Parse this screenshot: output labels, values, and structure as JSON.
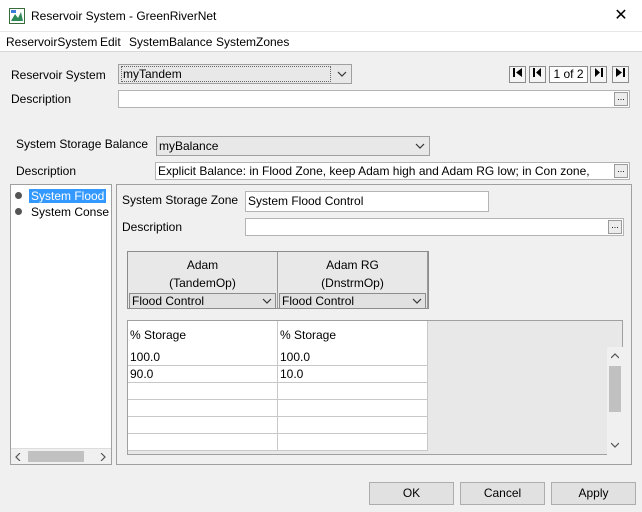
{
  "window": {
    "title": "Reservoir System - GreenRiverNet",
    "close_glyph": "✕"
  },
  "menu": [
    {
      "label": "ReservoirSystem"
    },
    {
      "label": "Edit"
    },
    {
      "label": "SystemBalance"
    },
    {
      "label": "SystemZones"
    }
  ],
  "reservoir_system": {
    "label": "Reservoir System",
    "value": "myTandem",
    "description_label": "Description",
    "description_value": "",
    "page_indicator": "1 of 2"
  },
  "storage_balance": {
    "label": "System Storage Balance",
    "value": "myBalance",
    "description_label": "Description",
    "description_value": "Explicit Balance: in Flood Zone, keep Adam high and Adam RG low; in Con zone,"
  },
  "tree": {
    "items": [
      {
        "label": "System Flood"
      },
      {
        "label": "System Conse"
      }
    ]
  },
  "zone": {
    "label": "System Storage Zone",
    "value": "System Flood Control",
    "description_label": "Description",
    "description_value": ""
  },
  "columns": [
    {
      "name": "Adam",
      "op": "(TandemOp)",
      "zone": "Flood Control",
      "header": "% Storage"
    },
    {
      "name": "Adam RG",
      "op": "(DnstrmOp)",
      "zone": "Flood Control",
      "header": "% Storage"
    }
  ],
  "rows": [
    [
      "100.0",
      "100.0"
    ],
    [
      "90.0",
      "10.0"
    ],
    [
      "",
      ""
    ],
    [
      "",
      ""
    ],
    [
      "",
      ""
    ],
    [
      "",
      ""
    ]
  ],
  "buttons": {
    "ok": "OK",
    "cancel": "Cancel",
    "apply": "Apply"
  },
  "ellipsis": "..."
}
